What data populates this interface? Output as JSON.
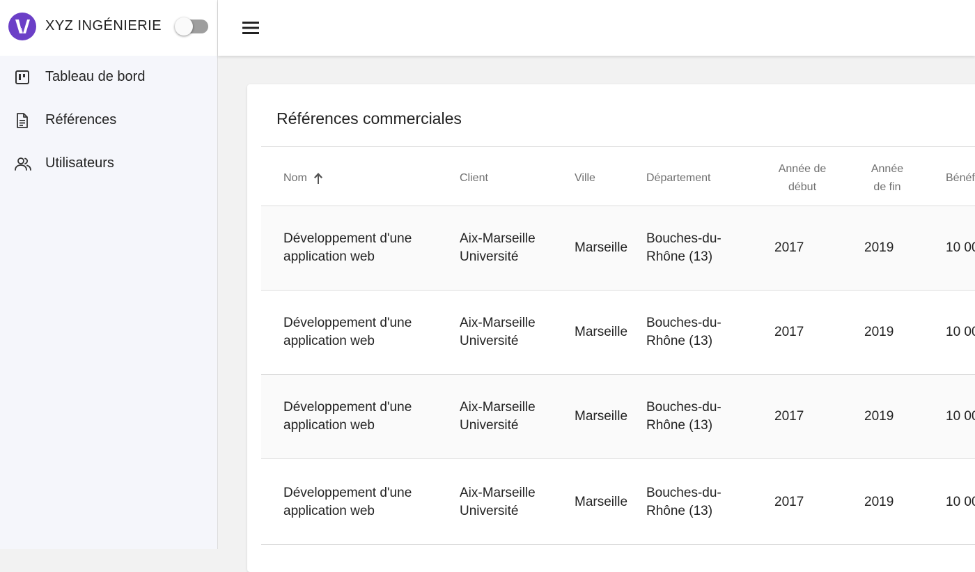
{
  "brand": {
    "name": "XYZ INGÉNIERIE",
    "logo_icon": "logo-v-icon",
    "accent": "#6b3fc7"
  },
  "sidebar": {
    "items": [
      {
        "label": "Tableau de bord",
        "icon": "dashboard-icon"
      },
      {
        "label": "Références",
        "icon": "document-icon"
      },
      {
        "label": "Utilisateurs",
        "icon": "users-icon"
      }
    ]
  },
  "topbar": {
    "menu_icon": "hamburger-menu-icon"
  },
  "card": {
    "title": "Références commerciales",
    "columns": [
      {
        "line1": "Nom",
        "line2": ""
      },
      {
        "line1": "Client",
        "line2": ""
      },
      {
        "line1": "Ville",
        "line2": ""
      },
      {
        "line1": "Département",
        "line2": ""
      },
      {
        "line1": "Année de",
        "line2": "début"
      },
      {
        "line1": "Année",
        "line2": "de fin"
      },
      {
        "line1": "Bénéf",
        "line2": ""
      }
    ],
    "sort_icon": "arrow-up-icon",
    "rows": [
      {
        "nom1": "Développement d'une",
        "nom2": "application web",
        "client1": "Aix-Marseille",
        "client2": "Université",
        "ville": "Marseille",
        "dep1": "Bouches-du-",
        "dep2": "Rhône (13)",
        "debut": "2017",
        "fin": "2019",
        "benef": "10 00"
      },
      {
        "nom1": "Développement d'une",
        "nom2": "application web",
        "client1": "Aix-Marseille",
        "client2": "Université",
        "ville": "Marseille",
        "dep1": "Bouches-du-",
        "dep2": "Rhône (13)",
        "debut": "2017",
        "fin": "2019",
        "benef": "10 00"
      },
      {
        "nom1": "Développement d'une",
        "nom2": "application web",
        "client1": "Aix-Marseille",
        "client2": "Université",
        "ville": "Marseille",
        "dep1": "Bouches-du-",
        "dep2": "Rhône (13)",
        "debut": "2017",
        "fin": "2019",
        "benef": "10 00"
      },
      {
        "nom1": "Développement d'une",
        "nom2": "application web",
        "client1": "Aix-Marseille",
        "client2": "Université",
        "ville": "Marseille",
        "dep1": "Bouches-du-",
        "dep2": "Rhône (13)",
        "debut": "2017",
        "fin": "2019",
        "benef": "10 00"
      }
    ]
  }
}
